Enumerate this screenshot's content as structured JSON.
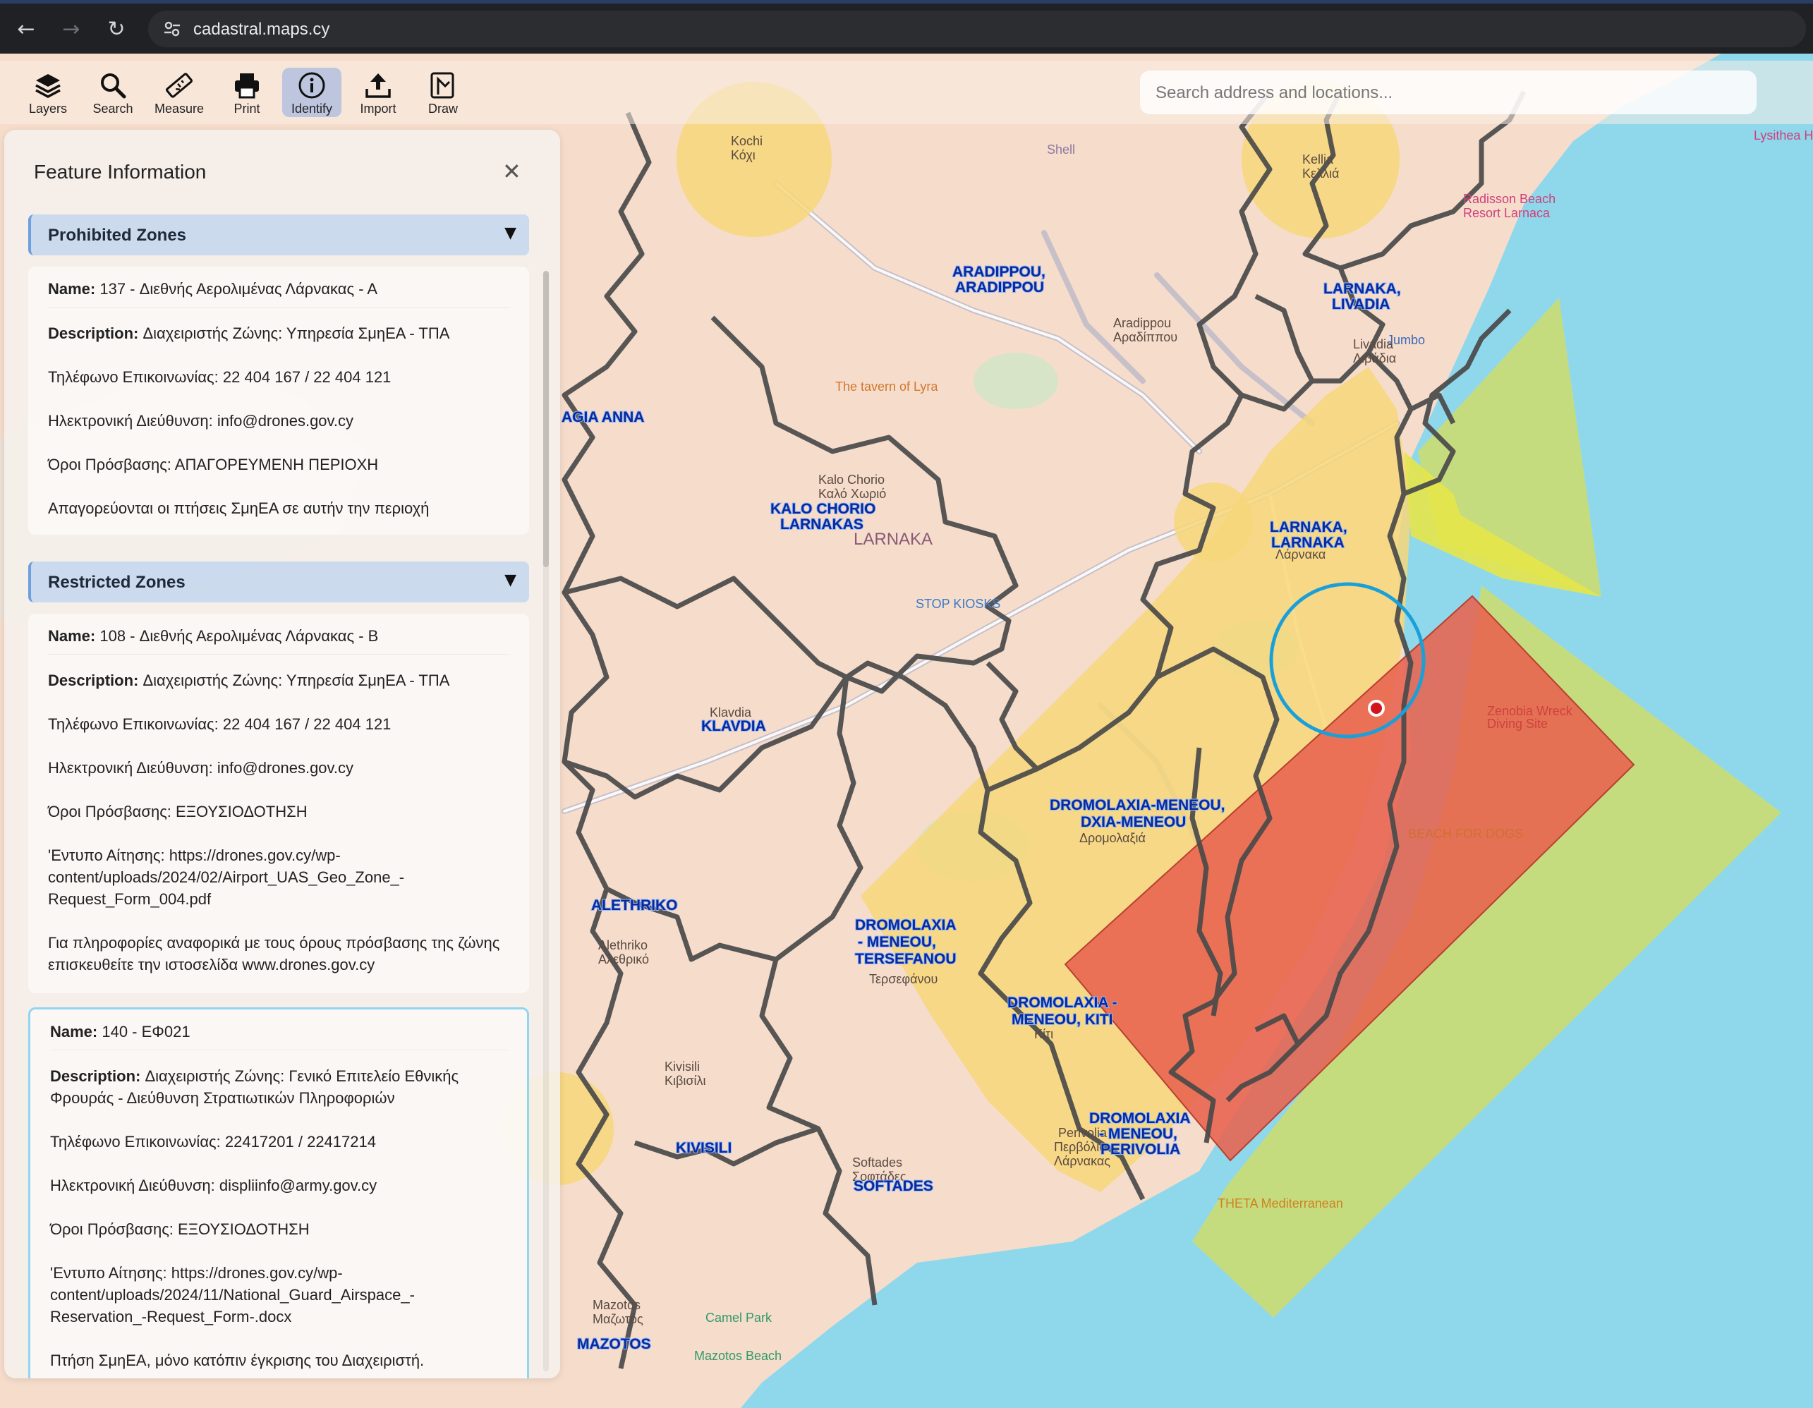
{
  "browser": {
    "url": "cadastral.maps.cy"
  },
  "toolbar": {
    "tools": [
      {
        "label": "Layers",
        "icon": "layers-icon"
      },
      {
        "label": "Search",
        "icon": "search-icon"
      },
      {
        "label": "Measure",
        "icon": "ruler-icon"
      },
      {
        "label": "Print",
        "icon": "printer-icon"
      },
      {
        "label": "Identify",
        "icon": "info-icon",
        "active": true
      },
      {
        "label": "Import",
        "icon": "upload-icon"
      },
      {
        "label": "Draw",
        "icon": "draw-icon"
      }
    ],
    "search_placeholder": "Search address and locations..."
  },
  "panel": {
    "title": "Feature Information",
    "sections": [
      {
        "title": "Prohibited Zones",
        "cards": [
          {
            "name_label": "Name:",
            "name": " 137 - Διεθνής Αερολιμένας Λάρνακας - Α",
            "description_label": "Description:",
            "description": " Διαχειριστής Ζώνης: Υπηρεσία ΣμηΕΑ - ΤΠΑ",
            "lines": [
              "Τηλέφωνο Επικοινωνίας: 22 404 167 / 22 404 121",
              "Ηλεκτρονική Διεύθυνση: info@drones.gov.cy",
              "Όροι Πρόσβασης: ΑΠΑΓΟΡΕΥΜΕΝΗ ΠΕΡΙΟΧΗ",
              "Απαγορεύονται οι πτήσεις ΣμηΕΑ σε αυτήν την περιοχή"
            ]
          }
        ]
      },
      {
        "title": "Restricted Zones",
        "cards": [
          {
            "name_label": "Name:",
            "name": " 108 - Διεθνής Αερολιμένας Λάρνακας - Β",
            "description_label": "Description:",
            "description": " Διαχειριστής Ζώνης: Υπηρεσία ΣμηΕΑ - ΤΠΑ",
            "lines": [
              "Τηλέφωνο Επικοινωνίας: 22 404 167 / 22 404 121",
              "Ηλεκτρονική Διεύθυνση: info@drones.gov.cy",
              "Όροι Πρόσβασης: ΕΞΟΥΣΙΟΔΟΤΗΣΗ",
              "'Εντυπο Αίτησης: https://drones.gov.cy/wp-content/uploads/2024/02/Airport_UAS_Geo_Zone_-Request_Form_004.pdf",
              "Για πληροφορίες αναφορικά με τους όρους πρόσβασης της ζώνης επισκευθείτε την ιστοσελίδα www.drones.gov.cy"
            ]
          },
          {
            "name_label": "Name:",
            "name": " 140 - ΕΦ021",
            "description_label": "Description:",
            "description": " Διαχειριστής Ζώνης: Γενικό Επιτελείο Εθνικής Φρουράς - Διεύθυνση Στρατιωτικών Πληροφοριών",
            "lines": [
              "Τηλέφωνο Επικοινωνίας: 22417201 / 22417214",
              "Ηλεκτρονική Διεύθυνση: displiinfo@army.gov.cy",
              "Όροι Πρόσβασης: ΕΞΟΥΣΙΟΔΟΤΗΣΗ",
              "'Εντυπο Αίτησης: https://drones.gov.cy/wp-content/uploads/2024/11/National_Guard_Airspace_-Reservation_-Request_Form-.docx",
              "Πτήση ΣμηΕΑ, μόνο κατόπιν έγκρισης του Διαχειριστή."
            ]
          }
        ]
      }
    ]
  },
  "map": {
    "colors": {
      "land": "#f6dccb",
      "sea": "#8fd8ec",
      "prohibited": "#e8624e",
      "restricted": "#f7d77a",
      "ctr": "#c8dc78",
      "yellow_zone": "#e6e64a",
      "boundary": "#4a4a4a",
      "selection": "#1aa0d8"
    },
    "district_labels": [
      "ARADIPPOU, ARADIPPOU",
      "LARNAKA, LIVADIA",
      "KALO CHORIO LARNAKAS",
      "LARNAKA, LARNAKA",
      "KLAVDIA",
      "DROMOLAXIA-MENEOU, DXIA-MENEOU",
      "DROMOLAXIA - MENEOU, TERSEFANOU",
      "DROMOLAXIA - MENEOU, KITI",
      "DROMOLAXIA - MENEOU, PERIVOLIA",
      "ALETHRIKO",
      "KIVISILI",
      "SOFTADES",
      "MAZOTOS",
      "AGIA ANNA"
    ],
    "town_labels": [
      "Kochi Κόχι",
      "Kellia Κελλιά",
      "Aradippou Αραδίππου",
      "Livadia Λιβάδια",
      "Kalo Chorio Καλό Χωριό",
      "LARNAKA",
      "Λάρνακα",
      "Klavdia",
      "Alethriko Αλεθρικό",
      "Kivisili Κιβισίλι",
      "Softades Σοφτάδες",
      "Mazotos Μαζωτός",
      "Δρομολαξιά",
      "Κίτι",
      "Perivolia Περβόλια Λάρνακας",
      "Τερσεφάνου",
      "Shell",
      "Jumbo",
      "STOP KIOSKS",
      "Radisson Beach Resort Larnaca",
      "Lysithea Ho",
      "The tavern of Lyra",
      "Zenobia Wreck Diving Site",
      "BEACH FOR DOGS",
      "THETA Mediterranean",
      "Mazotos Beach",
      "Camel Park"
    ]
  }
}
